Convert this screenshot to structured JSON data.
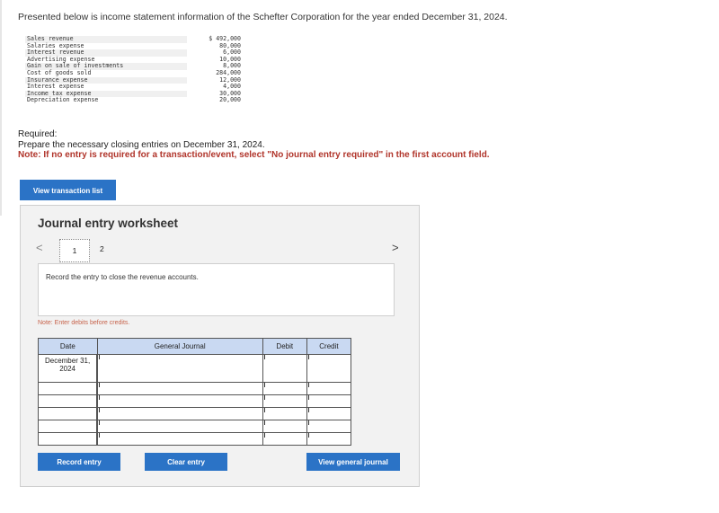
{
  "intro": "Presented below is income statement information of the Schefter Corporation for the year ended December 31, 2024.",
  "accounts": [
    {
      "label": "Sales revenue",
      "value": "$ 492,000"
    },
    {
      "label": "Salaries expense",
      "value": "80,000"
    },
    {
      "label": "Interest revenue",
      "value": "6,000"
    },
    {
      "label": "Advertising expense",
      "value": "10,000"
    },
    {
      "label": "Gain on sale of investments",
      "value": "8,000"
    },
    {
      "label": "Cost of goods sold",
      "value": "284,000"
    },
    {
      "label": "Insurance expense",
      "value": "12,000"
    },
    {
      "label": "Interest expense",
      "value": "4,000"
    },
    {
      "label": "Income tax expense",
      "value": "30,000"
    },
    {
      "label": "Depreciation expense",
      "value": "20,000"
    }
  ],
  "required": {
    "heading": "Required:",
    "text": "Prepare the necessary closing entries on December 31, 2024.",
    "note": "Note: If no entry is required for a transaction/event, select \"No journal entry required\" in the first account field."
  },
  "buttons": {
    "view_transaction_list": "View transaction list",
    "record_entry": "Record entry",
    "clear_entry": "Clear entry",
    "view_general_journal": "View general journal"
  },
  "worksheet": {
    "title": "Journal entry worksheet",
    "prev": "<",
    "next": ">",
    "pages": [
      "1",
      "2"
    ],
    "prompt": "Record the entry to close the revenue accounts.",
    "enter_note": "Note: Enter debits before credits.",
    "columns": {
      "date": "Date",
      "journal": "General Journal",
      "debit": "Debit",
      "credit": "Credit"
    },
    "first_date": "December 31, 2024"
  }
}
